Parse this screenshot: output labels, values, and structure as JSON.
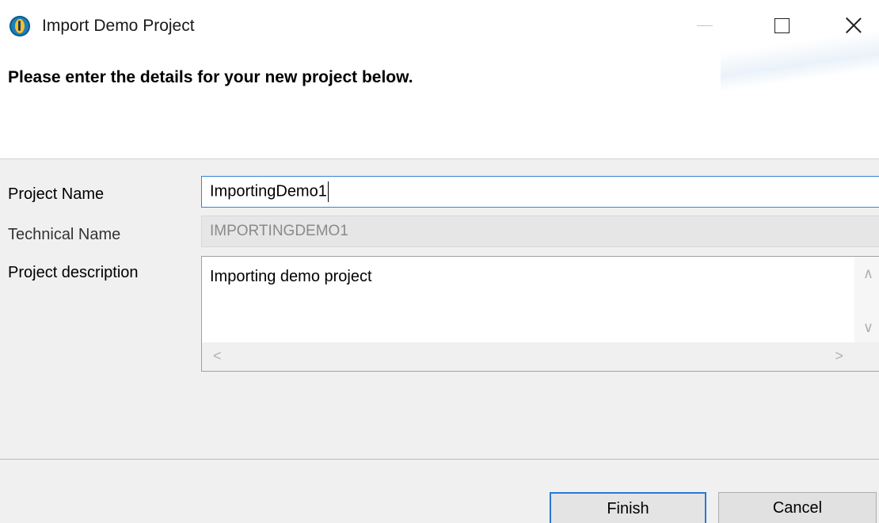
{
  "window": {
    "title": "Import Demo Project",
    "icon": "talend-app-icon"
  },
  "banner": {
    "title": "Please enter the details for your new project below."
  },
  "form": {
    "project_name": {
      "label": "Project Name",
      "value": "ImportingDemo1"
    },
    "technical_name": {
      "label": "Technical Name",
      "value": "IMPORTINGDEMO1"
    },
    "project_description": {
      "label": "Project description",
      "value": "Importing demo project"
    }
  },
  "buttons": {
    "finish": "Finish",
    "cancel": "Cancel"
  },
  "colors": {
    "focus_border": "#3a84d6",
    "default_button_border": "#2a78d4",
    "disabled_text": "#8a8a8a"
  }
}
